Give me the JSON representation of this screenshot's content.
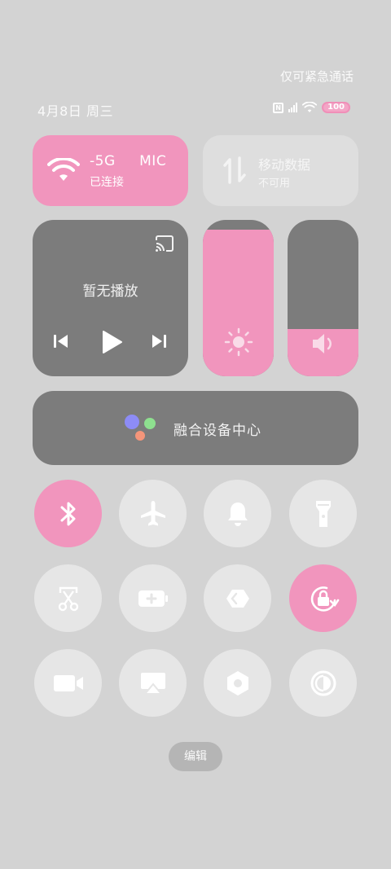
{
  "status": {
    "emergency_text": "仅可紧急通话",
    "date": "4月8日 周三",
    "battery": "100"
  },
  "wifi_tile": {
    "name": "-5G     MIC",
    "status": "已连接",
    "icon": "wifi-icon"
  },
  "mobile_tile": {
    "title": "移动数据",
    "status": "不可用",
    "icon": "mobile-data-icon"
  },
  "media": {
    "text": "暂无播放",
    "icons": [
      "cast-icon",
      "previous-icon",
      "play-icon",
      "next-icon"
    ]
  },
  "brightness": {
    "level": 0.94,
    "icon": "sun-icon"
  },
  "volume": {
    "level": 0.3,
    "icon": "speaker-icon"
  },
  "device_center": {
    "label": "融合设备中心"
  },
  "toggles": [
    {
      "name": "bluetooth",
      "icon": "bluetooth-icon",
      "on": true
    },
    {
      "name": "airplane",
      "icon": "airplane-icon",
      "on": false
    },
    {
      "name": "ring",
      "icon": "bell-icon",
      "on": false
    },
    {
      "name": "flashlight",
      "icon": "flashlight-icon",
      "on": false
    },
    {
      "name": "screenshot",
      "icon": "scissors-icon",
      "on": false
    },
    {
      "name": "battery-saver",
      "icon": "battery-plus-icon",
      "on": false
    },
    {
      "name": "share",
      "icon": "share-icon",
      "on": false
    },
    {
      "name": "rotation-lock",
      "icon": "rotation-lock-icon",
      "on": true
    },
    {
      "name": "screen-record",
      "icon": "video-camera-icon",
      "on": false
    },
    {
      "name": "screen-cast",
      "icon": "airplay-icon",
      "on": false
    },
    {
      "name": "settings",
      "icon": "hexagon-nut-icon",
      "on": false
    },
    {
      "name": "dark-mode",
      "icon": "contrast-icon",
      "on": false
    }
  ],
  "edit_label": "编辑",
  "colors": {
    "accent": "#f195bd",
    "tile_dark": "#7c7c7c",
    "tile_light": "#e6e6e6",
    "background": "#d3d3d3"
  }
}
